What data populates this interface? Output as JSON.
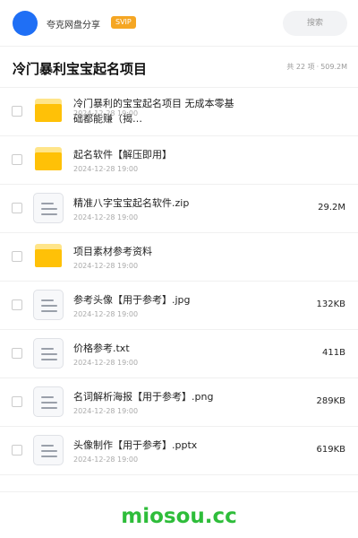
{
  "header": {
    "uploader": "夸克网盘分享",
    "badge": "SVIP",
    "search_label": "搜索"
  },
  "title_row": {
    "title": "冷门暴利宝宝起名项目",
    "count": "共 22 项",
    "separator": "·",
    "total_size": "509.2M"
  },
  "files": [
    {
      "type": "folder",
      "name": "冷门暴利的宝宝起名项目 无成本零基础都能赚（揭…",
      "date": "2024-12-28 19:00",
      "size": ""
    },
    {
      "type": "folder",
      "name": "起名软件【解压即用】",
      "date": "2024-12-28 19:00",
      "size": ""
    },
    {
      "type": "file",
      "name": "精准八字宝宝起名软件.zip",
      "date": "2024-12-28 19:00",
      "size": "29.2M"
    },
    {
      "type": "folder",
      "name": "项目素材参考资料",
      "date": "2024-12-28 19:00",
      "size": ""
    },
    {
      "type": "file",
      "name": "参考头像【用于参考】.jpg",
      "date": "2024-12-28 19:00",
      "size": "132KB"
    },
    {
      "type": "file",
      "name": "价格参考.txt",
      "date": "2024-12-28 19:00",
      "size": "411B"
    },
    {
      "type": "file",
      "name": "名词解析海报【用于参考】.png",
      "date": "2024-12-28 19:00",
      "size": "289KB"
    },
    {
      "type": "file",
      "name": "头像制作【用于参考】.pptx",
      "date": "2024-12-28 19:00",
      "size": "619KB"
    }
  ],
  "footer": {
    "brand": "miosou.cc"
  },
  "colors": {
    "avatar": "#1f6ff5",
    "svip_badge": "#f5a623",
    "folder": "#ffc107",
    "brand": "#2ebd3a"
  },
  "icons": {
    "folder": "folder-icon",
    "file": "document-icon",
    "checkbox": "checkbox-icon"
  }
}
